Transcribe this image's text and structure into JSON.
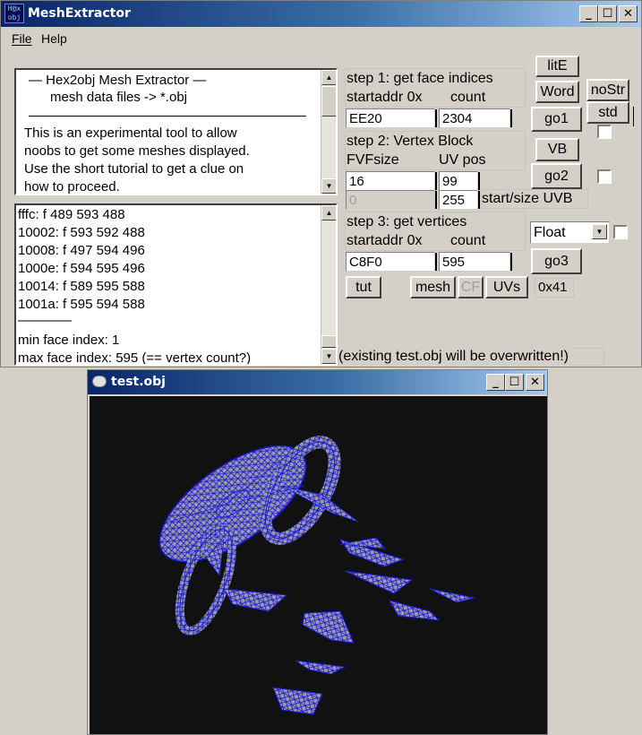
{
  "main_window": {
    "title": "MeshExtractor",
    "app_icon_text": "H@x obj",
    "menu": [
      "File",
      "Help"
    ]
  },
  "info_text": {
    "line1": "—   Hex2obj Mesh Extractor   —",
    "line2": "mesh data files -> *.obj",
    "body": [
      "This is an experimental tool to allow",
      "noobs to get some meshes displayed.",
      "Use the short tutorial to get a clue on",
      "how to proceed."
    ]
  },
  "log": {
    "lines": [
      "fffc: f  489 593 488",
      "10002: f  593 592 488",
      "10008: f  497 594 496",
      "1000e: f  594 595 496",
      "10014: f  589 595 588",
      "1001a: f  595 594 588",
      "————",
      "min face index: 1",
      "max face index: 595 (== vertex count?)"
    ]
  },
  "step1": {
    "title": "step 1: get face indices",
    "startaddr_label": "startaddr 0x",
    "count_label": "count",
    "startaddr_value": "EE20",
    "count_value": "2304"
  },
  "step2": {
    "title": "step 2: Vertex Block",
    "fvf_label": "FVFsize",
    "uvpos_label": "UV pos",
    "fvf_value": "16",
    "uvpos_value": "99",
    "uvb_start_value": "0",
    "uvb_size_value": "255",
    "uvb_label": "start/size UVB"
  },
  "step3": {
    "title": "step 3: get vertices",
    "startaddr_label": "startaddr 0x",
    "count_label": "count",
    "startaddr_value": "C8F0",
    "count_value": "595",
    "type_selected": "Float"
  },
  "buttons": {
    "lite": "litE",
    "word": "Word",
    "nostr": "noStr",
    "go1": "go1",
    "std": "std",
    "vb": "VB",
    "go2": "go2",
    "go3": "go3",
    "tut": "tut",
    "mesh": "mesh",
    "cf": "CF",
    "uvs": "UVs",
    "hex": "0x41"
  },
  "status_text": "(existing test.obj will be overwritten!)",
  "viewer_window": {
    "title": "test.obj"
  },
  "colors": {
    "titlebar_start": "#0a246a",
    "window_face": "#d4d0c8",
    "viewport_bg": "#111111",
    "mesh_wire": "#1a1ad0",
    "mesh_fill": "#9a9aa8"
  }
}
